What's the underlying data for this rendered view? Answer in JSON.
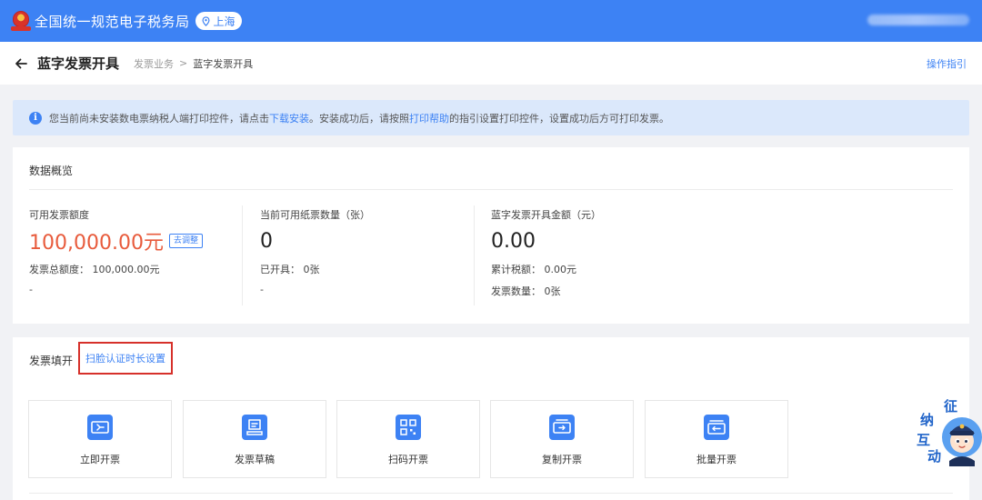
{
  "header": {
    "app_title": "全国统一规范电子税务局",
    "location": "上海",
    "emblem_icon": "tax-emblem-icon",
    "accent": "#3d82f4"
  },
  "page": {
    "title": "蓝字发票开具",
    "breadcrumb": [
      "发票业务",
      "蓝字发票开具"
    ],
    "breadcrumb_sep": ">",
    "guide_link": "操作指引"
  },
  "notice": {
    "text_1": "您当前尚未安装数电票纳税人端打印控件，请点击",
    "link_download": "下载安装",
    "text_2": "。安装成功后，请按照",
    "link_help": "打印帮助",
    "text_3": "的指引设置打印控件，设置成功后方可打印发票。"
  },
  "overview": {
    "title": "数据概览",
    "metrics": [
      {
        "label": "可用发票额度",
        "value": "100,000.00元",
        "action": "去调整",
        "sub1": "发票总额度：  100,000.00元",
        "sub2": "-"
      },
      {
        "label": "当前可用纸票数量（张）",
        "value": "0",
        "sub1": "已开具：  0张",
        "sub2": "-"
      },
      {
        "label": "蓝字发票开具金额（元）",
        "value": "0.00",
        "sub1": "累计税额：  0.00元",
        "sub2": "发票数量：  0张"
      }
    ]
  },
  "fill": {
    "title": "发票填开",
    "face_setting_link": "扫脸认证时长设置",
    "tiles": [
      {
        "label": "立即开票",
        "icon": "issue-invoice-icon"
      },
      {
        "label": "发票草稿",
        "icon": "invoice-draft-icon"
      },
      {
        "label": "扫码开票",
        "icon": "qr-code-icon"
      },
      {
        "label": "复制开票",
        "icon": "copy-invoice-icon"
      },
      {
        "label": "批量开票",
        "icon": "batch-invoice-icon"
      }
    ]
  },
  "mascot": {
    "chars": [
      "征",
      "纳",
      "互",
      "动"
    ],
    "icon": "service-mascot-icon"
  }
}
